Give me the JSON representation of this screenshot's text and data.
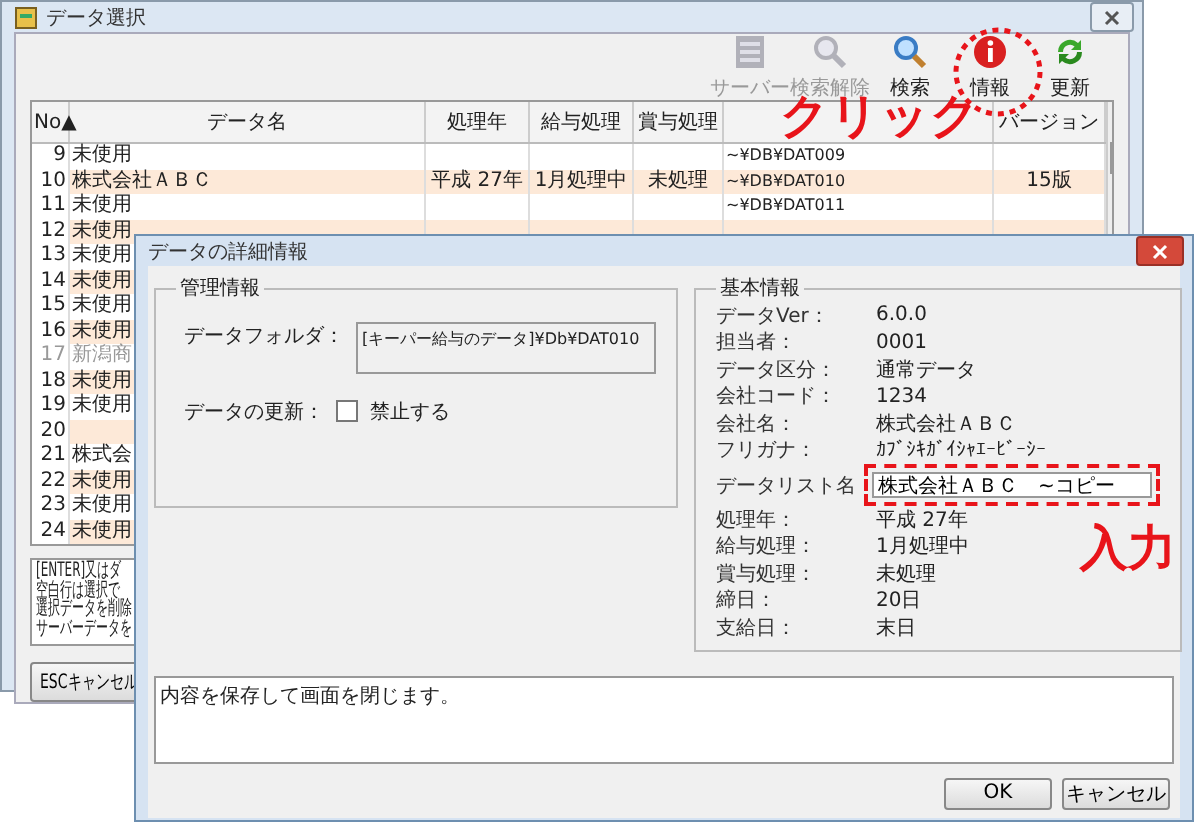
{
  "window": {
    "title": "データ選択"
  },
  "toolbar": [
    {
      "kind": "server",
      "label": "サーバー",
      "disabled": true
    },
    {
      "kind": "clear-search",
      "label": "検索解除",
      "disabled": true
    },
    {
      "kind": "search",
      "label": "検索",
      "disabled": false
    },
    {
      "kind": "info",
      "label": "情報",
      "disabled": false
    },
    {
      "kind": "refresh",
      "label": "更新",
      "disabled": false
    }
  ],
  "table": {
    "columns": [
      "No▲",
      "データ名",
      "処理年",
      "給与処理",
      "賞与処理",
      "",
      "バージョン"
    ],
    "rows": [
      {
        "no": "9",
        "name": "未使用",
        "folder": "~¥DB¥DAT009",
        "disabled": false
      },
      {
        "no": "10",
        "name": "株式会社ＡＢＣ",
        "year": "平成 27年",
        "salary": "1月処理中",
        "bonus": "未処理",
        "folder": "~¥DB¥DAT010",
        "version": "15版",
        "disabled": false
      },
      {
        "no": "11",
        "name": "未使用",
        "folder": "~¥DB¥DAT011",
        "disabled": false
      },
      {
        "no": "12",
        "name": "未使用",
        "disabled": false
      },
      {
        "no": "13",
        "name": "未使用",
        "disabled": false
      },
      {
        "no": "14",
        "name": "未使用",
        "disabled": false
      },
      {
        "no": "15",
        "name": "未使用",
        "disabled": false
      },
      {
        "no": "16",
        "name": "未使用",
        "disabled": false
      },
      {
        "no": "17",
        "name": "新潟商",
        "disabled": true
      },
      {
        "no": "18",
        "name": "未使用",
        "disabled": false
      },
      {
        "no": "19",
        "name": "未使用",
        "disabled": false
      },
      {
        "no": "20",
        "disabled": false
      },
      {
        "no": "21",
        "name": "株式会",
        "disabled": false
      },
      {
        "no": "22",
        "name": "未使用",
        "disabled": false
      },
      {
        "no": "23",
        "name": "未使用",
        "disabled": false
      },
      {
        "no": "24",
        "name": "未使用",
        "disabled": false
      }
    ]
  },
  "notes": [
    "[ENTER]又はダ",
    "空白行は選択で",
    "選択データを削除",
    "サーバーデータを"
  ],
  "cancel_button": "ESCキャンセル",
  "dialog": {
    "title": "データの詳細情報",
    "management": {
      "title": "管理情報",
      "folder_label": "データフォルダ：",
      "folder_value": "[キーパー給与のデータ]¥Db¥DAT010",
      "update_label": "データの更新：",
      "lock_label": "禁止する",
      "lock_checked": false
    },
    "basic": {
      "title": "基本情報",
      "items": [
        {
          "kind": "text",
          "label": "データVer：",
          "value": "6.0.0"
        },
        {
          "kind": "text",
          "label": "担当者：",
          "value": "0001"
        },
        {
          "kind": "text",
          "label": "データ区分：",
          "value": "通常データ"
        },
        {
          "kind": "text",
          "label": "会社コード：",
          "value": "1234"
        },
        {
          "kind": "text",
          "label": "会社名：",
          "value": "株式会社ＡＢＣ"
        },
        {
          "kind": "text",
          "label": "フリガナ：",
          "value": "ｶﾌﾞｼｷｶﾞｲｼｬｴｰﾋﾞｰｼｰ"
        },
        {
          "kind": "field",
          "label": "データリスト名",
          "value": "株式会社ＡＢＣ　~コピー"
        },
        {
          "kind": "text",
          "label": "処理年：",
          "value": "平成 27年"
        },
        {
          "kind": "text",
          "label": "給与処理：",
          "value": "1月処理中"
        },
        {
          "kind": "text",
          "label": "賞与処理：",
          "value": "未処理"
        },
        {
          "kind": "text",
          "label": "締日：",
          "value": "20日"
        },
        {
          "kind": "text",
          "label": "支給日：",
          "value": "末日"
        }
      ]
    },
    "message": "内容を保存して画面を閉じます。",
    "buttons": [
      "OK",
      "キャンセル"
    ]
  },
  "annotations": [
    {
      "kind": "click",
      "text": "クリック"
    },
    {
      "kind": "input",
      "text": "入力"
    }
  ]
}
